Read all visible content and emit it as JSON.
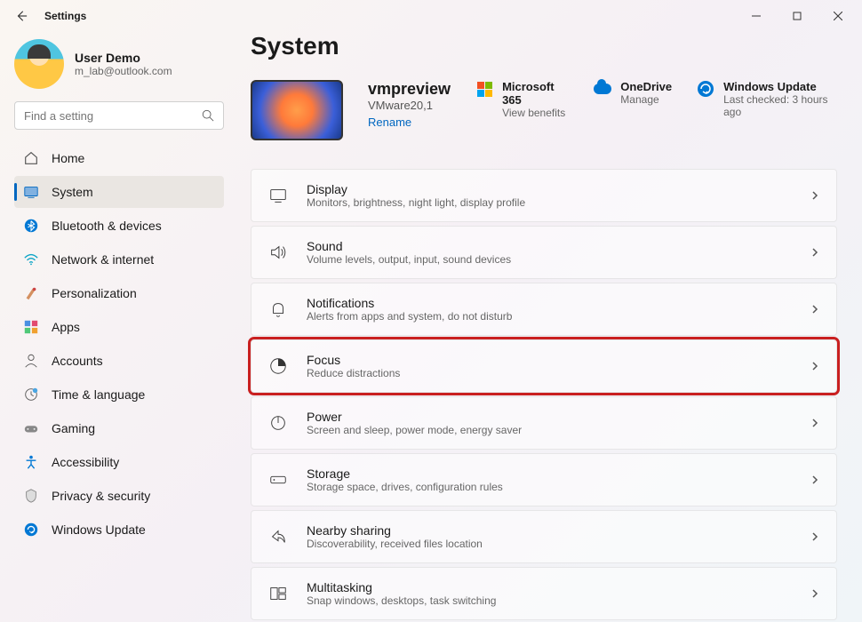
{
  "titlebar": {
    "title": "Settings"
  },
  "profile": {
    "name": "User Demo",
    "email": "m_lab@outlook.com"
  },
  "search": {
    "placeholder": "Find a setting"
  },
  "sidebar": {
    "items": [
      {
        "label": "Home"
      },
      {
        "label": "System"
      },
      {
        "label": "Bluetooth & devices"
      },
      {
        "label": "Network & internet"
      },
      {
        "label": "Personalization"
      },
      {
        "label": "Apps"
      },
      {
        "label": "Accounts"
      },
      {
        "label": "Time & language"
      },
      {
        "label": "Gaming"
      },
      {
        "label": "Accessibility"
      },
      {
        "label": "Privacy & security"
      },
      {
        "label": "Windows Update"
      }
    ]
  },
  "page": {
    "title": "System"
  },
  "device": {
    "name": "vmpreview",
    "model": "VMware20,1",
    "rename": "Rename"
  },
  "status": {
    "m365": {
      "title": "Microsoft 365",
      "sub": "View benefits"
    },
    "onedrive": {
      "title": "OneDrive",
      "sub": "Manage"
    },
    "winupdate": {
      "title": "Windows Update",
      "sub": "Last checked: 3 hours ago"
    }
  },
  "settings": [
    {
      "title": "Display",
      "sub": "Monitors, brightness, night light, display profile"
    },
    {
      "title": "Sound",
      "sub": "Volume levels, output, input, sound devices"
    },
    {
      "title": "Notifications",
      "sub": "Alerts from apps and system, do not disturb"
    },
    {
      "title": "Focus",
      "sub": "Reduce distractions"
    },
    {
      "title": "Power",
      "sub": "Screen and sleep, power mode, energy saver"
    },
    {
      "title": "Storage",
      "sub": "Storage space, drives, configuration rules"
    },
    {
      "title": "Nearby sharing",
      "sub": "Discoverability, received files location"
    },
    {
      "title": "Multitasking",
      "sub": "Snap windows, desktops, task switching"
    }
  ]
}
